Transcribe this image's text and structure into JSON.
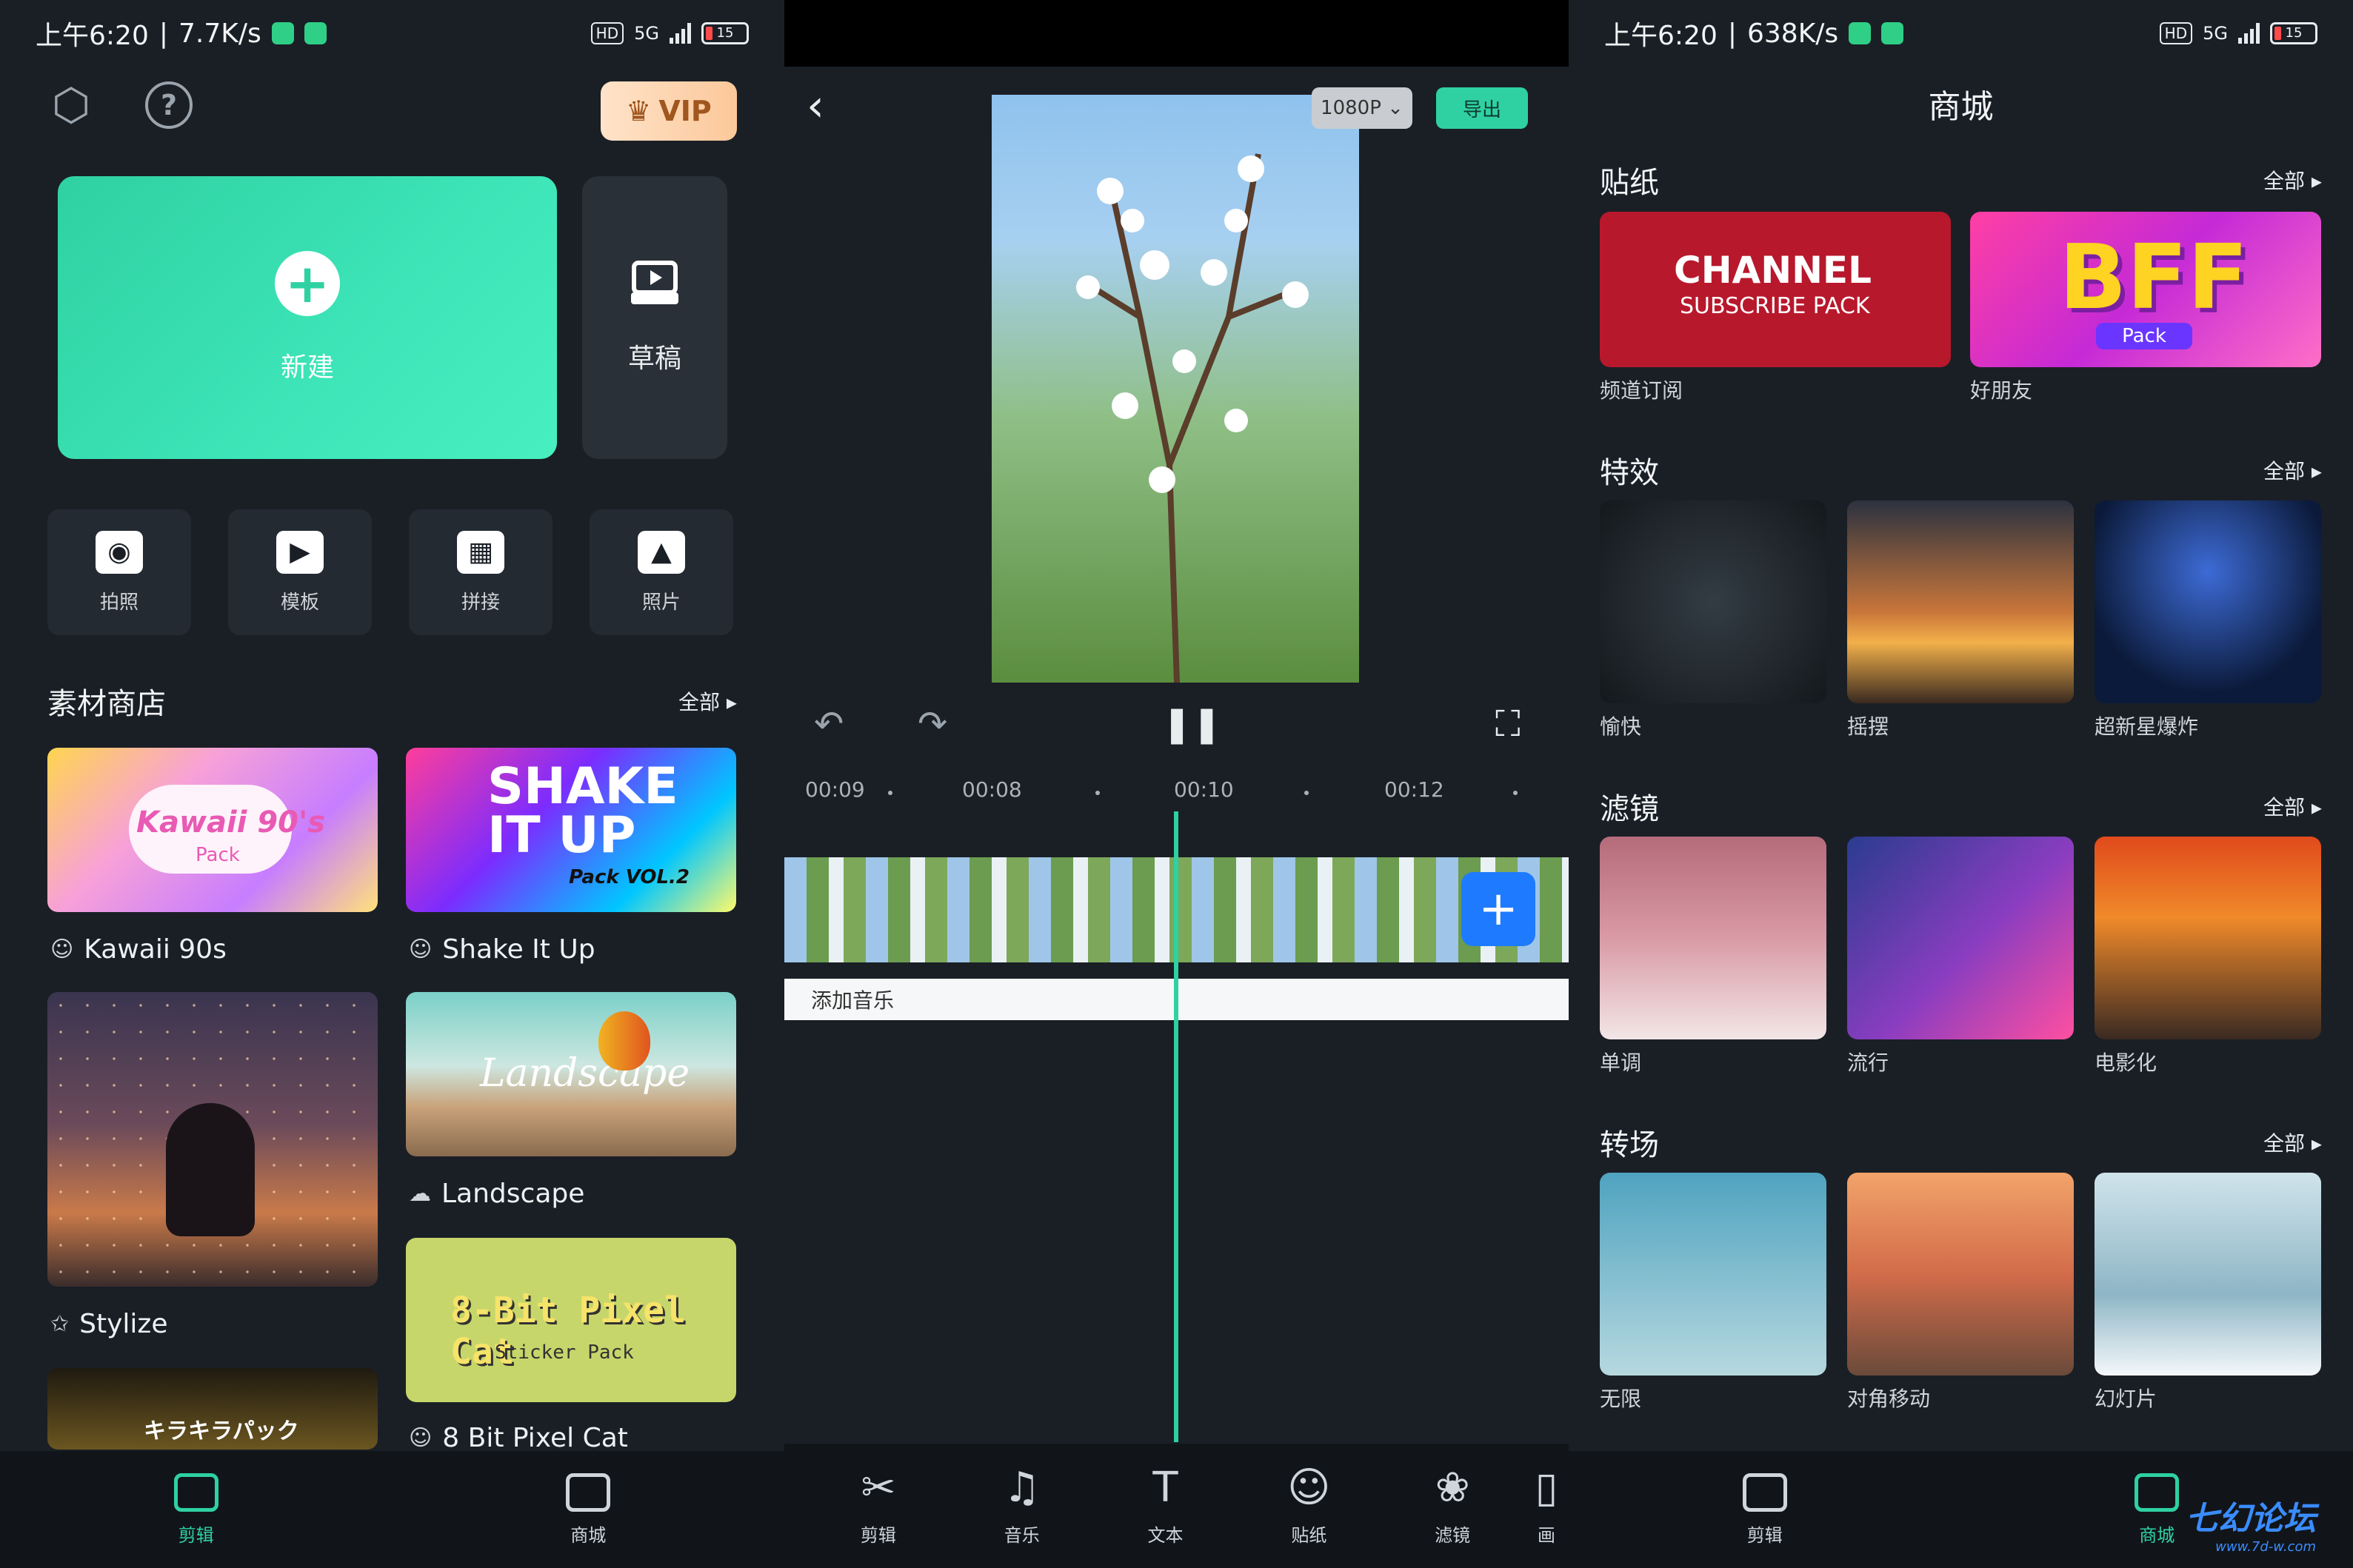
{
  "left_panel": {
    "status": {
      "time": "上午6:20",
      "speed": "7.7K/s",
      "hd": "HD",
      "net": "5G",
      "battery": "15"
    },
    "vip_label": "VIP",
    "new_label": "新建",
    "draft_label": "草稿",
    "tiles": [
      {
        "label": "拍照",
        "icon": "camera-icon"
      },
      {
        "label": "模板",
        "icon": "template-icon"
      },
      {
        "label": "拼接",
        "icon": "collage-icon"
      },
      {
        "label": "照片",
        "icon": "photo-icon"
      }
    ],
    "store_title": "素材商店",
    "store_all": "全部 ▸",
    "store_cards": [
      {
        "card_text": "Kawaii 90's",
        "card_sub": "Pack",
        "caption": "Kawaii 90s"
      },
      {
        "card_text": "SHAKE IT UP",
        "card_sub": "Pack VOL.2",
        "caption": "Shake It Up"
      },
      {
        "caption": "Stylize"
      },
      {
        "card_text": "Landscape",
        "caption": "Landscape"
      },
      {
        "card_text": "8-Bit Pixel Cat",
        "card_sub": "Sticker Pack",
        "caption": "8 Bit Pixel Cat"
      },
      {
        "card_text": "キラキラパック"
      }
    ],
    "nav": [
      {
        "label": "剪辑"
      },
      {
        "label": "商城"
      }
    ]
  },
  "editor_panel": {
    "resolution": "1080P",
    "export_label": "导出",
    "timeline_labels": [
      "00:09",
      "00:08",
      "00:10",
      "00:12"
    ],
    "add_music": "添加音乐",
    "tools": [
      {
        "label": "剪辑",
        "icon": "scissors-icon"
      },
      {
        "label": "音乐",
        "icon": "music-icon"
      },
      {
        "label": "文本",
        "icon": "text-icon"
      },
      {
        "label": "贴纸",
        "icon": "sticker-icon"
      },
      {
        "label": "滤镜",
        "icon": "filter-icon"
      },
      {
        "label": "画"
      }
    ]
  },
  "store_panel": {
    "status": {
      "time": "上午6:20",
      "speed": "638K/s",
      "hd": "HD",
      "net": "5G",
      "battery": "15"
    },
    "title": "商城",
    "all_label": "全部 ▸",
    "sections": [
      {
        "title": "贴纸",
        "items": [
          {
            "label": "频道订阅",
            "card_text": "CHANNEL",
            "card_sub": "SUBSCRIBE PACK"
          },
          {
            "label": "好朋友",
            "card_text": "BFF",
            "card_sub": "Pack"
          }
        ]
      },
      {
        "title": "特效",
        "items": [
          {
            "label": "愉快"
          },
          {
            "label": "摇摆"
          },
          {
            "label": "超新星爆炸"
          }
        ]
      },
      {
        "title": "滤镜",
        "items": [
          {
            "label": "单调"
          },
          {
            "label": "流行"
          },
          {
            "label": "电影化"
          }
        ]
      },
      {
        "title": "转场",
        "items": [
          {
            "label": "无限"
          },
          {
            "label": "对角移动"
          },
          {
            "label": "幻灯片"
          }
        ]
      }
    ],
    "nav": [
      {
        "label": "剪辑"
      },
      {
        "label": "商城"
      }
    ],
    "watermark": "七幻论坛",
    "watermark_url": "www.7d-w.com"
  },
  "colors": {
    "accent": "#2fd1a2",
    "blue": "#1e7bff",
    "bg": "#1a1f26"
  }
}
